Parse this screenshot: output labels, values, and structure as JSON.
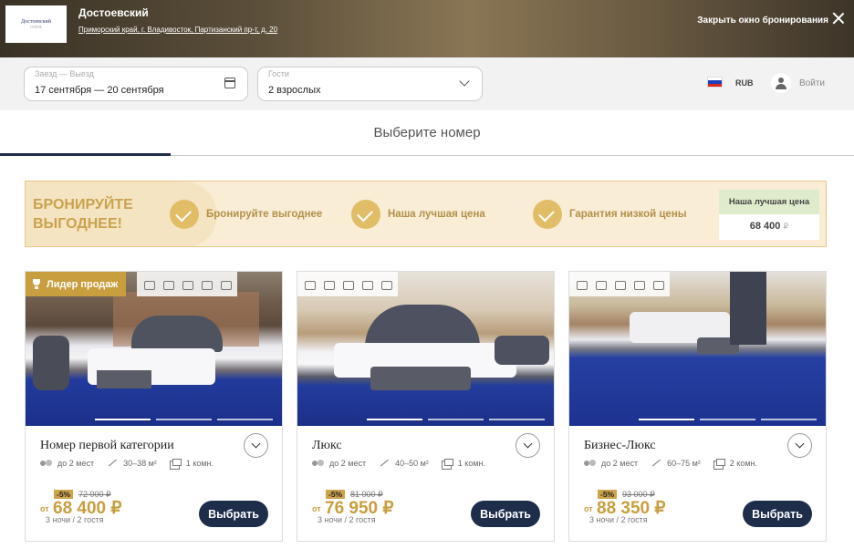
{
  "hotel": {
    "logo_text": "Достоевский",
    "logo_sub": "ОТЕЛЬ",
    "name": "Достоевский",
    "address": "Приморский край, г. Владивосток, Партизанский пр-т, д. 20",
    "close_label": "Закрыть окно бронирования"
  },
  "search": {
    "dates_label": "Заезд — Выезд",
    "dates_value": "17 сентября — 20 сентября",
    "guests_label": "Гости",
    "guests_value": "2 взрослых"
  },
  "header_right": {
    "currency": "RUB",
    "login": "Войти",
    "flag_colors": [
      "#ffffff",
      "#1c3fbb",
      "#d52b1e"
    ]
  },
  "tab": {
    "title": "Выберите номер"
  },
  "promo": {
    "title": "БРОНИРУЙТЕ ВЫГОДНЕЕ!",
    "items": [
      "Бронируйте выгоднее",
      "Наша лучшая цена",
      "Гарантия низкой цены"
    ],
    "box_title": "Наша лучшая цена",
    "box_price": "68 400",
    "box_currency": "₽"
  },
  "rooms": [
    {
      "badge": "Лидер продаж",
      "name": "Номер первой категории",
      "guests": "до 2 мест",
      "area": "30–38 м²",
      "rooms": "1 комн.",
      "discount": "-5%",
      "old_price": "72 000 ₽",
      "from": "от",
      "price": "68 400 ₽",
      "nights": "3 ночи / 2 гостя",
      "button": "Выбрать"
    },
    {
      "name": "Люкс",
      "guests": "до 2 мест",
      "area": "40–50 м²",
      "rooms": "1 комн.",
      "discount": "-5%",
      "old_price": "81 000 ₽",
      "from": "от",
      "price": "76 950 ₽",
      "nights": "3 ночи / 2 гостя",
      "button": "Выбрать"
    },
    {
      "name": "Бизнес-Люкс",
      "guests": "до 2 мест",
      "area": "60–75 м²",
      "rooms": "2 комн.",
      "discount": "-5%",
      "old_price": "93 000 ₽",
      "from": "от",
      "price": "88 350 ₽",
      "nights": "3 ночи / 2 гостя",
      "button": "Выбрать"
    }
  ]
}
